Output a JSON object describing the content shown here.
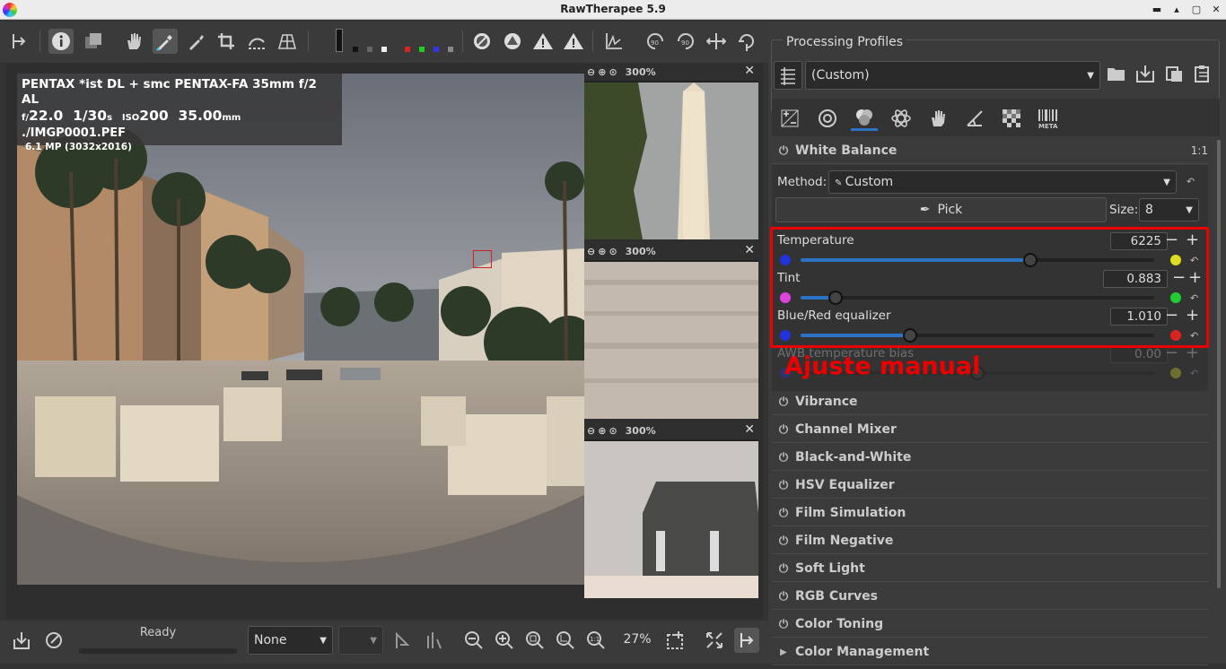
{
  "window": {
    "title": "RawTherapee 5.9"
  },
  "exif": {
    "line1": "PENTAX *ist DL + smc PENTAX-FA 35mm f/2 AL",
    "aperture_prefix": "f/",
    "aperture": "22.0",
    "shutter": "1/30",
    "shutter_unit": "s",
    "iso_label": "ISO",
    "iso": "200",
    "focal": "35.00",
    "focal_unit": "mm",
    "filename": "./IMGP0001.PEF",
    "megapixels": "6.1 MP (3032x2016)"
  },
  "detail_windows": [
    {
      "zoom": "300%"
    },
    {
      "zoom": "300%"
    },
    {
      "zoom": "300%"
    }
  ],
  "bottom": {
    "status": "Ready",
    "processing_combo": "None",
    "zoom": "27%"
  },
  "profiles": {
    "header": "Processing Profiles",
    "selected": "(Custom)"
  },
  "white_balance": {
    "title": "White Balance",
    "ratio": "1:1",
    "method_label": "Method:",
    "method_value": "Custom",
    "pick_label": "Pick",
    "size_label": "Size:",
    "size_value": "8",
    "temperature_label": "Temperature",
    "temperature_value": "6225",
    "temperature_fraction": 0.65,
    "tint_label": "Tint",
    "tint_value": "0.883",
    "tint_fraction": 0.1,
    "equalizer_label": "Blue/Red equalizer",
    "equalizer_value": "1.010",
    "equalizer_fraction": 0.31,
    "awb_label": "AWB temperature bias",
    "awb_value": "0.00",
    "awb_fraction": 0.5
  },
  "annotation": "Ajuste manual",
  "tools": [
    "Vibrance",
    "Channel Mixer",
    "Black-and-White",
    "HSV Equalizer",
    "Film Simulation",
    "Film Negative",
    "Soft Light",
    "RGB Curves",
    "Color Toning",
    "Color Management"
  ],
  "colors": {
    "accent": "#2c73c5",
    "highlight": "#ee0000"
  }
}
